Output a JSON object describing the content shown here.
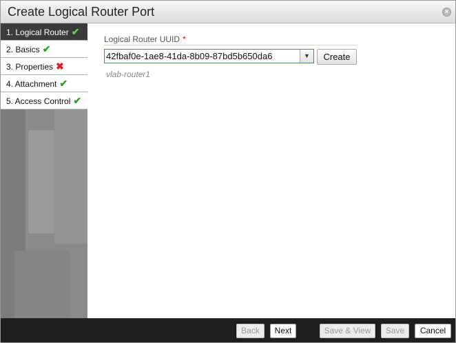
{
  "dialog": {
    "title": "Create Logical Router Port",
    "close_icon": "close-icon"
  },
  "sidebar": {
    "items": [
      {
        "label": "1. Logical Router",
        "status": "complete",
        "status_glyph": "✔",
        "active": true
      },
      {
        "label": "2. Basics",
        "status": "complete",
        "status_glyph": "✔",
        "active": false
      },
      {
        "label": "3. Properties",
        "status": "error",
        "status_glyph": "✖",
        "active": false
      },
      {
        "label": "4. Attachment",
        "status": "complete",
        "status_glyph": "✔",
        "active": false
      },
      {
        "label": "5. Access Control",
        "status": "complete",
        "status_glyph": "✔",
        "active": false
      }
    ]
  },
  "form": {
    "uuid_label": "Logical Router UUID",
    "required_marker": "*",
    "uuid_value": "42fbaf0e-1ae8-41da-8b09-87bd5b650da6",
    "dropdown_arrow": "▼",
    "create_label": "Create",
    "router_name": "vlab-router1"
  },
  "footer": {
    "back_label": "Back",
    "next_label": "Next",
    "save_view_label": "Save & View",
    "save_label": "Save",
    "cancel_label": "Cancel"
  },
  "colors": {
    "active_nav": "#3b3b3b",
    "check": "#2da02d",
    "error": "#e02020",
    "footer": "#1e1e1e",
    "focus_border": "#3f7bd6"
  }
}
